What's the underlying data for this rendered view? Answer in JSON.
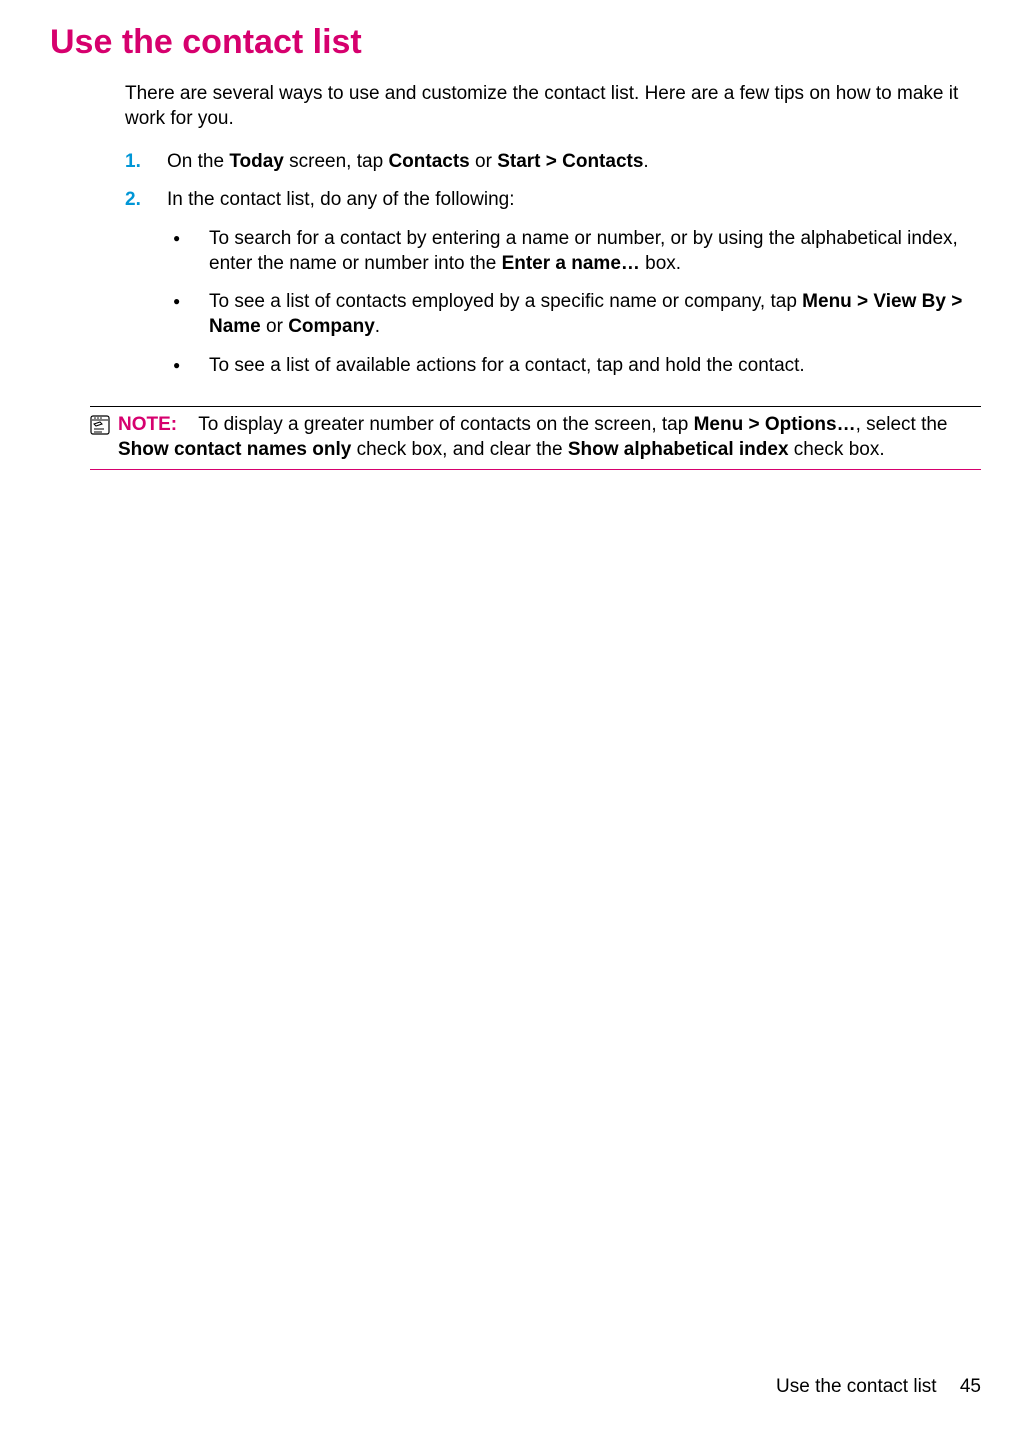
{
  "heading": "Use the contact list",
  "intro": "There are several ways to use and customize the contact list. Here are a few tips on how to make it work for you.",
  "steps": [
    {
      "marker": "1.",
      "segments": [
        {
          "t": "On the "
        },
        {
          "t": "Today",
          "b": true
        },
        {
          "t": " screen, tap "
        },
        {
          "t": "Contacts",
          "b": true
        },
        {
          "t": " or "
        },
        {
          "t": "Start > Contacts",
          "b": true
        },
        {
          "t": "."
        }
      ]
    },
    {
      "marker": "2.",
      "segments": [
        {
          "t": "In the contact list, do any of the following:"
        }
      ],
      "bullets": [
        {
          "segments": [
            {
              "t": "To search for a contact by entering a name or number, or by using the alphabetical index, enter the name or number into the "
            },
            {
              "t": "Enter a name…",
              "b": true
            },
            {
              "t": " box."
            }
          ]
        },
        {
          "segments": [
            {
              "t": "To see a list of contacts employed by a specific name or company, tap "
            },
            {
              "t": "Menu > View By > Name",
              "b": true
            },
            {
              "t": " or "
            },
            {
              "t": "Company",
              "b": true
            },
            {
              "t": "."
            }
          ]
        },
        {
          "segments": [
            {
              "t": "To see a list of available actions for a contact, tap and hold the contact."
            }
          ]
        }
      ]
    }
  ],
  "note": {
    "label": "NOTE:",
    "segments": [
      {
        "t": "To display a greater number of contacts on the screen, tap "
      },
      {
        "t": "Menu > Options…",
        "b": true
      },
      {
        "t": ", select the "
      },
      {
        "t": "Show contact names only",
        "b": true
      },
      {
        "t": " check box, and clear the "
      },
      {
        "t": "Show alphabetical index",
        "b": true
      },
      {
        "t": " check box."
      }
    ]
  },
  "footer": {
    "title": "Use the contact list",
    "page": "45"
  }
}
